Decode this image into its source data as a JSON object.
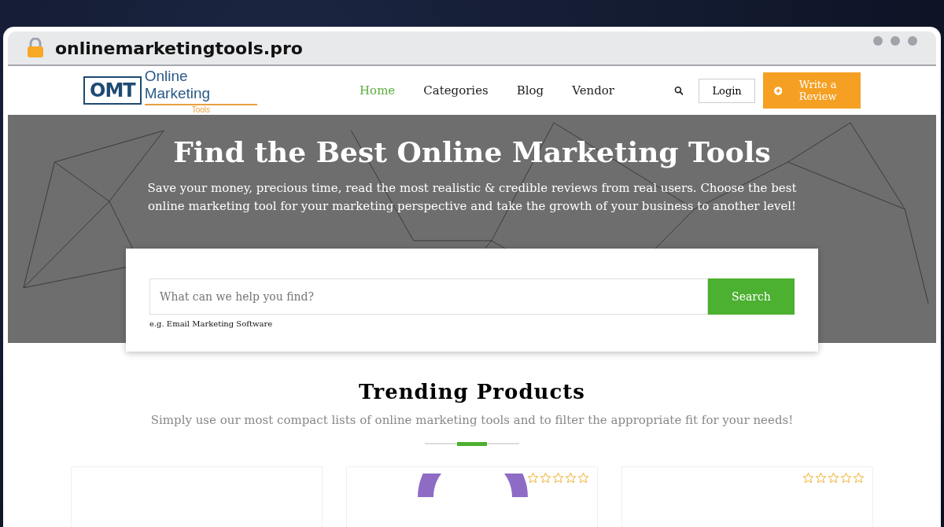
{
  "browser": {
    "url": "onlinemarketingtools.pro"
  },
  "logo": {
    "mark": "OMT",
    "name": "Online Marketing",
    "tagline": "Tools"
  },
  "nav": [
    {
      "label": "Home",
      "selected": true
    },
    {
      "label": "Categories",
      "selected": false
    },
    {
      "label": "Blog",
      "selected": false
    },
    {
      "label": "Vendor",
      "selected": false
    }
  ],
  "header_buttons": {
    "login": "Login",
    "review": "Write a Review"
  },
  "hero": {
    "title": "Find the Best Online Marketing Tools",
    "subtitle": "Save your money, precious time, read the most realistic & credible reviews from real users. Choose the best online marketing tool for your marketing perspective and take the growth of your business to another level!"
  },
  "search": {
    "placeholder": "What can we help you find?",
    "button": "Search",
    "hint": "e.g. Email Marketing Software"
  },
  "trending": {
    "title": "Trending Products",
    "subtitle": "Simply use our most compact lists of online marketing tools and to filter the appropriate fit for your needs!"
  },
  "cards": [
    {
      "kind": "plain"
    },
    {
      "kind": "logo",
      "stars": 0
    },
    {
      "kind": "plain",
      "stars": 0
    }
  ]
}
